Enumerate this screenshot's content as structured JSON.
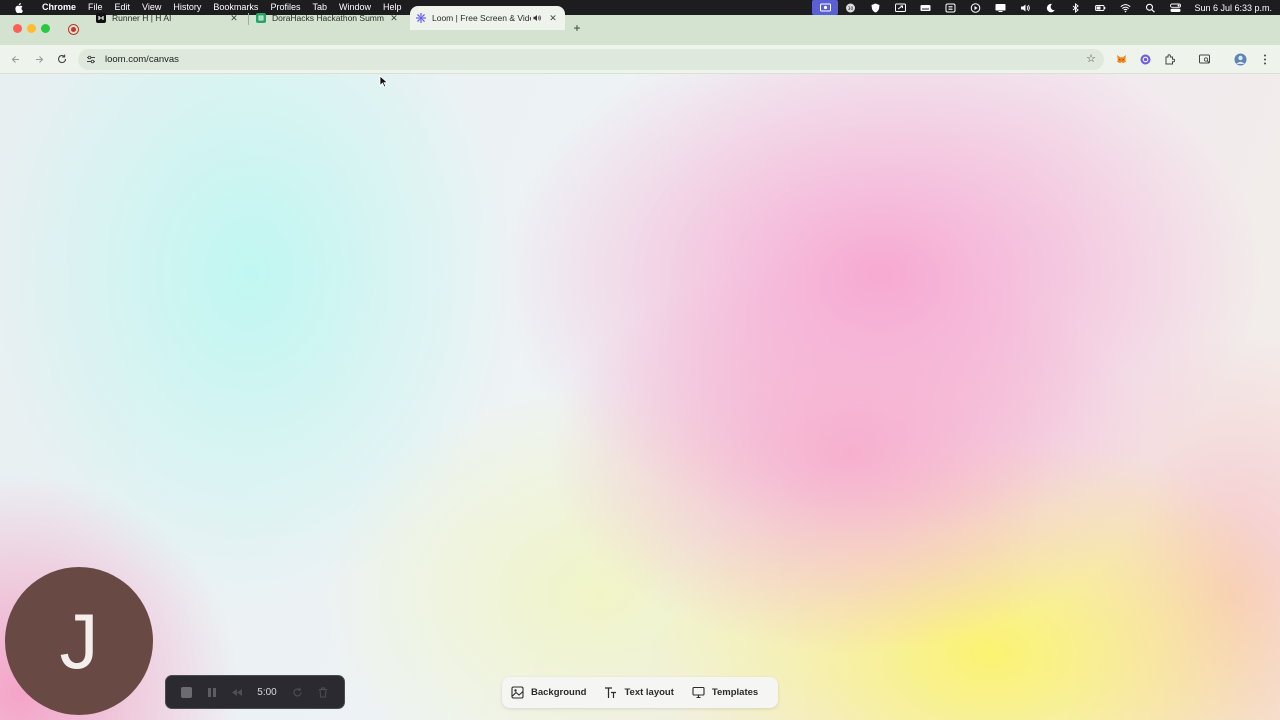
{
  "menubar": {
    "app": "Chrome",
    "items": [
      "File",
      "Edit",
      "View",
      "History",
      "Bookmarks",
      "Profiles",
      "Tab",
      "Window",
      "Help"
    ],
    "clock": "Sun 6 Jul  6:33 p.m."
  },
  "tabs": [
    {
      "title": "Runner H | H AI",
      "favicon": "runner-h-icon"
    },
    {
      "title": "DoraHacks Hackathon Summ",
      "favicon": "google-sheets-icon"
    },
    {
      "title": "Loom | Free Screen & Vide",
      "favicon": "loom-icon",
      "active": true
    }
  ],
  "toolbar": {
    "url": "loom.com/canvas"
  },
  "camera": {
    "initial": "J"
  },
  "recording": {
    "time": "5:00"
  },
  "bottom_bar": {
    "background": "Background",
    "text_layout": "Text layout",
    "templates": "Templates"
  },
  "colors": {
    "camera_bubble": "#684943",
    "tabstrip": "#d3e3cf",
    "recording_bar": "#2a2a30"
  }
}
